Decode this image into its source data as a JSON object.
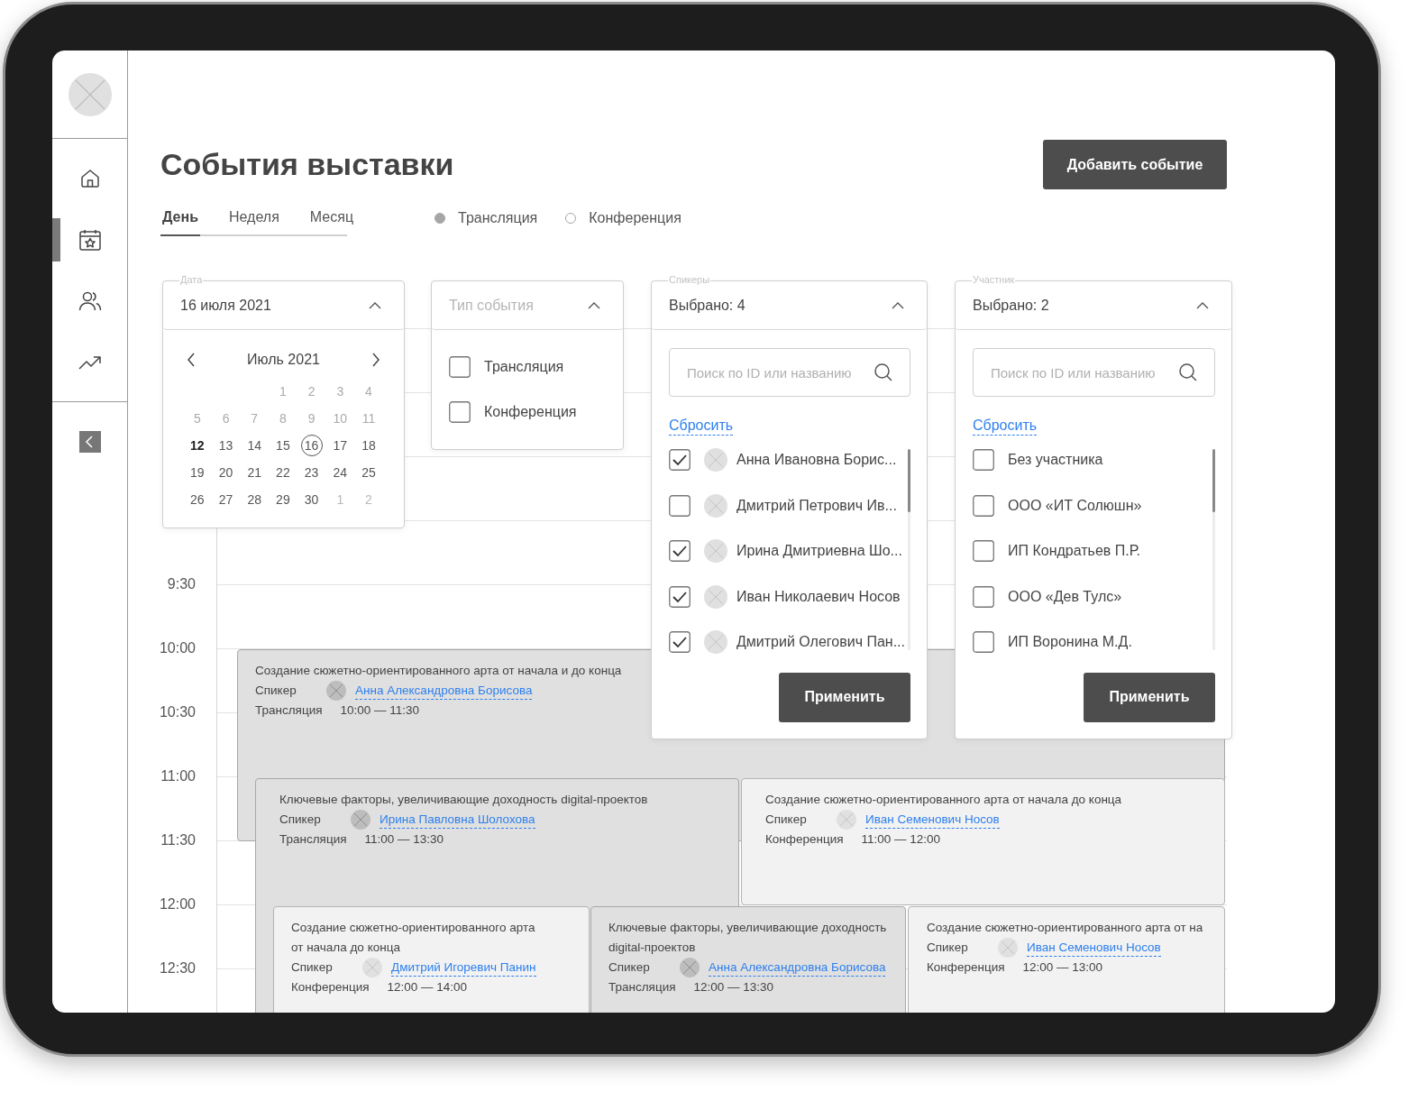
{
  "sidebar": {
    "nav": [
      {
        "kind": "home",
        "selected": false
      },
      {
        "kind": "calendar",
        "selected": true
      },
      {
        "kind": "users",
        "selected": false
      },
      {
        "kind": "chart",
        "selected": false
      }
    ]
  },
  "header": {
    "title": "События выставки",
    "add_button": "Добавить событие"
  },
  "tabs": [
    {
      "label": "День",
      "selected": true
    },
    {
      "label": "Неделя",
      "selected": false
    },
    {
      "label": "Месяц",
      "selected": false
    }
  ],
  "legend": [
    {
      "label": "Трансляция",
      "color": "#a6a6a6"
    },
    {
      "label": "Конференция",
      "color": "#ffffff"
    }
  ],
  "filters": {
    "date": {
      "label": "Дата",
      "value": "16 июля 2021",
      "expanded": true,
      "calendar": {
        "month": "Июль 2021",
        "weeks": [
          [
            {
              "label": "1",
              "kind": "past",
              "selected": false
            },
            {
              "label": "2",
              "kind": "past",
              "selected": false
            },
            {
              "label": "3",
              "kind": "past",
              "selected": false
            },
            {
              "label": "4",
              "kind": "past",
              "selected": false
            }
          ],
          [
            {
              "label": "5",
              "kind": "past",
              "selected": false
            },
            {
              "label": "6",
              "kind": "past",
              "selected": false
            },
            {
              "label": "7",
              "kind": "past",
              "selected": false
            },
            {
              "label": "8",
              "kind": "past",
              "selected": false
            },
            {
              "label": "9",
              "kind": "past",
              "selected": false
            },
            {
              "label": "10",
              "kind": "past",
              "selected": false
            },
            {
              "label": "11",
              "kind": "past",
              "selected": false
            }
          ],
          [
            {
              "label": "12",
              "kind": "today",
              "selected": false
            },
            {
              "label": "13",
              "kind": "normal",
              "selected": false
            },
            {
              "label": "14",
              "kind": "normal",
              "selected": false
            },
            {
              "label": "15",
              "kind": "normal",
              "selected": false
            },
            {
              "label": "16",
              "kind": "normal",
              "selected": true
            },
            {
              "label": "17",
              "kind": "normal",
              "selected": false
            },
            {
              "label": "18",
              "kind": "normal",
              "selected": false
            }
          ],
          [
            {
              "label": "19",
              "kind": "normal",
              "selected": false
            },
            {
              "label": "20",
              "kind": "normal",
              "selected": false
            },
            {
              "label": "21",
              "kind": "normal",
              "selected": false
            },
            {
              "label": "22",
              "kind": "normal",
              "selected": false
            },
            {
              "label": "23",
              "kind": "normal",
              "selected": false
            },
            {
              "label": "24",
              "kind": "normal",
              "selected": false
            },
            {
              "label": "25",
              "kind": "normal",
              "selected": false
            }
          ],
          [
            {
              "label": "26",
              "kind": "normal",
              "selected": false
            },
            {
              "label": "27",
              "kind": "normal",
              "selected": false
            },
            {
              "label": "28",
              "kind": "normal",
              "selected": false
            },
            {
              "label": "29",
              "kind": "normal",
              "selected": false
            },
            {
              "label": "30",
              "kind": "normal",
              "selected": false
            },
            {
              "label": "1",
              "kind": "other",
              "selected": false
            },
            {
              "label": "2",
              "kind": "other",
              "selected": false
            }
          ]
        ]
      }
    },
    "type": {
      "placeholder": "Тип события",
      "expanded": true,
      "options": [
        {
          "label": "Трансляция",
          "checked": false
        },
        {
          "label": "Конференция",
          "checked": false
        }
      ]
    },
    "speakers": {
      "label": "Спикеры",
      "value": "Выбрано: 4",
      "expanded": true,
      "search": {
        "placeholder": "Поиск по ID или названию"
      },
      "reset": "Сбросить",
      "items": [
        {
          "name": "Анна Ивановна Борис...",
          "checked": true
        },
        {
          "name": "Дмитрий Петрович Ив...",
          "checked": false
        },
        {
          "name": "Ирина Дмитриевна Шо...",
          "checked": true
        },
        {
          "name": "Иван Николаевич Носов",
          "checked": true
        },
        {
          "name": "Дмитрий Олегович Пан...",
          "checked": true
        }
      ],
      "apply": "Применить"
    },
    "participant": {
      "label": "Участник",
      "value": "Выбрано: 2",
      "expanded": true,
      "search": {
        "placeholder": "Поиск по ID или названию"
      },
      "reset": "Сбросить",
      "items": [
        {
          "name": "Без участника",
          "checked": false
        },
        {
          "name": "ООО «ИТ Солюшн»",
          "checked": false
        },
        {
          "name": "ИП Кондратьев П.Р.",
          "checked": false
        },
        {
          "name": "ООО «Дев Тулс»",
          "checked": false
        },
        {
          "name": "ИП Воронина М.Д.",
          "checked": false
        }
      ],
      "apply": "Применить"
    }
  },
  "timeline": {
    "times": [
      "9:30",
      "10:00",
      "10:30",
      "11:00",
      "11:30",
      "12:00",
      "12:30"
    ],
    "events": [
      {
        "kind": "broadcast",
        "title": "Создание сюжетно-ориентированного арта от начала и до конца",
        "speaker_label": "Спикер",
        "speaker": "Анна Александровна Борисова",
        "type": "Трансляция",
        "time": "10:00 — 11:30"
      },
      {
        "kind": "broadcast",
        "title": "Ключевые факторы, увеличивающие доходность digital-проектов",
        "speaker_label": "Спикер",
        "speaker": "Ирина Павловна Шолохова",
        "type": "Трансляция",
        "time": "11:00 — 13:30"
      },
      {
        "kind": "conference",
        "title": "Создание сюжетно-ориентированного арта от начала до конца",
        "speaker_label": "Спикер",
        "speaker": "Иван Семенович Носов",
        "type": "Конференция",
        "time": "11:00 — 12:00"
      },
      {
        "kind": "conference",
        "title": "Создание сюжетно-ориентированного арта от начала до конца",
        "speaker_label": "Спикер",
        "speaker": "Дмитрий Игоревич Панин",
        "type": "Конференция",
        "time": "12:00 — 14:00"
      },
      {
        "kind": "broadcast",
        "title": "Ключевые факторы, увеличивающие доходность digital-проектов",
        "speaker_label": "Спикер",
        "speaker": "Анна Александровна Борисова",
        "type": "Трансляция",
        "time": "12:00 — 13:30"
      },
      {
        "kind": "conference",
        "title": "Создание сюжетно-ориентированного арта от на",
        "speaker_label": "Спикер",
        "speaker": "Иван Семенович Носов",
        "type": "Конференция",
        "time": "12:00 — 13:00"
      }
    ]
  }
}
